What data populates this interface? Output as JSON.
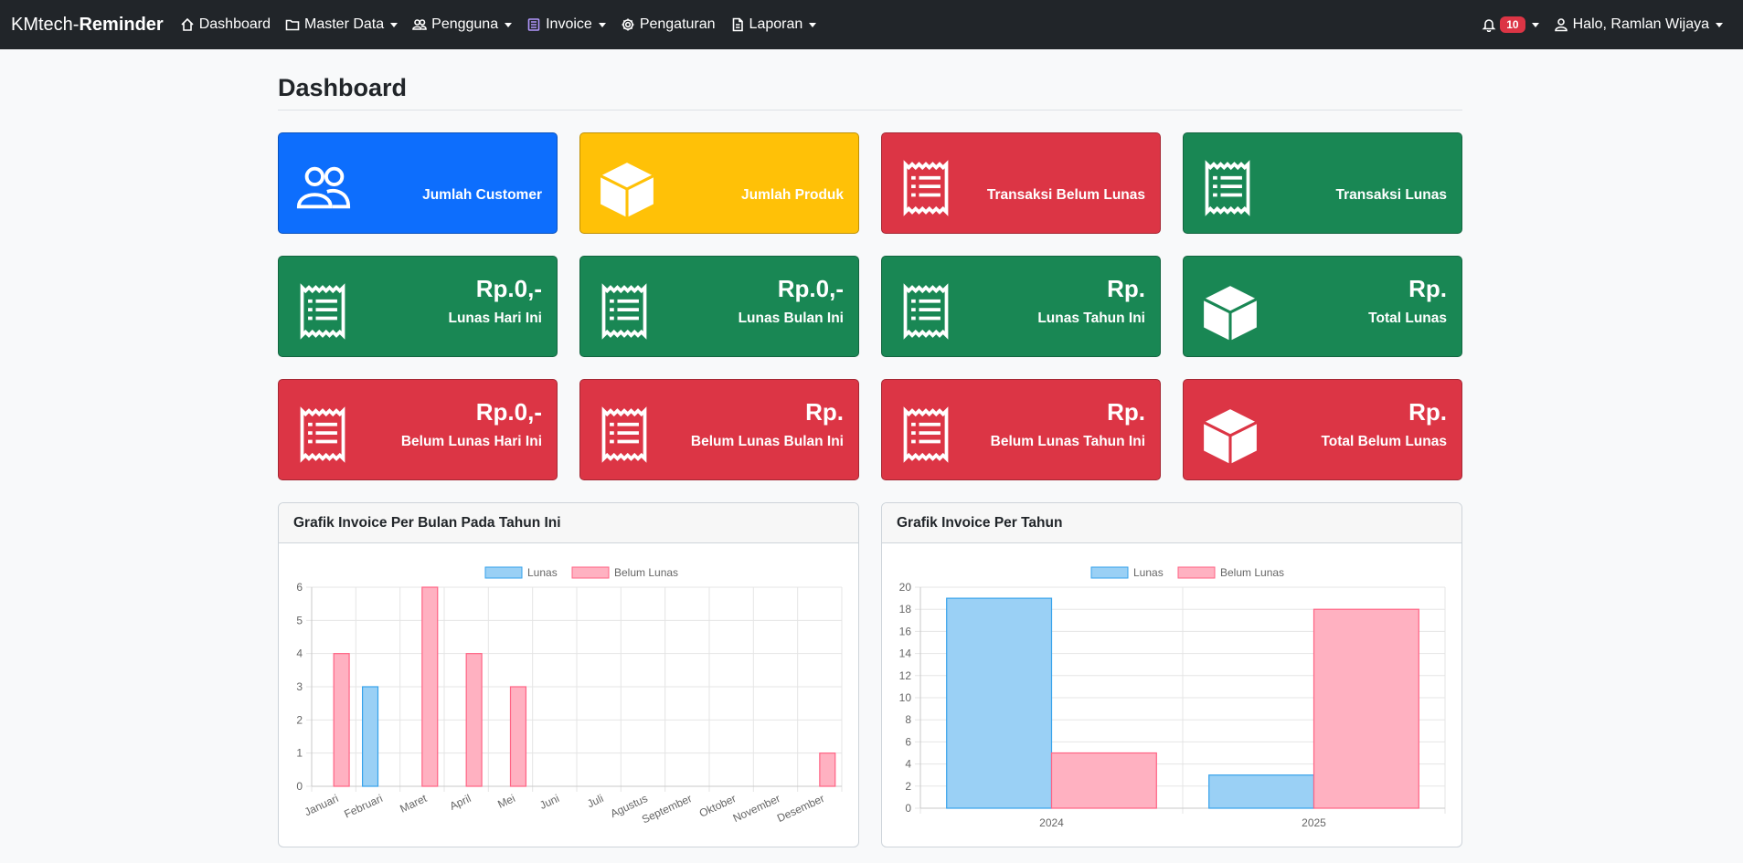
{
  "navbar": {
    "brand_light": "KMtech-",
    "brand_bold": "Reminder",
    "items": [
      {
        "label": "Dashboard"
      },
      {
        "label": "Master Data"
      },
      {
        "label": "Pengguna"
      },
      {
        "label": "Invoice"
      },
      {
        "label": "Pengaturan"
      },
      {
        "label": "Laporan"
      }
    ],
    "notification_count": "10",
    "user_greeting": "Halo, Ramlan Wijaya"
  },
  "page": {
    "title": "Dashboard"
  },
  "cards": [
    {
      "label": "Jumlah Customer",
      "amount": "",
      "color": "#0d6efd",
      "icon": "users-icon"
    },
    {
      "label": "Jumlah Produk",
      "amount": "",
      "color": "#ffc107",
      "icon": "box-icon"
    },
    {
      "label": "Transaksi Belum Lunas",
      "amount": "",
      "color": "#dc3545",
      "icon": "receipt-icon"
    },
    {
      "label": "Transaksi Lunas",
      "amount": "",
      "color": "#198754",
      "icon": "receipt-icon"
    },
    {
      "label": "Lunas Hari Ini",
      "amount": "Rp.0,-",
      "color": "#198754",
      "icon": "receipt-icon"
    },
    {
      "label": "Lunas Bulan Ini",
      "amount": "Rp.0,-",
      "color": "#198754",
      "icon": "receipt-icon"
    },
    {
      "label": "Lunas Tahun Ini",
      "amount": "Rp.",
      "color": "#198754",
      "icon": "receipt-icon"
    },
    {
      "label": "Total Lunas",
      "amount": "Rp.",
      "color": "#198754",
      "icon": "box-icon"
    },
    {
      "label": "Belum Lunas Hari Ini",
      "amount": "Rp.0,-",
      "color": "#dc3545",
      "icon": "receipt-icon"
    },
    {
      "label": "Belum Lunas Bulan Ini",
      "amount": "Rp.",
      "color": "#dc3545",
      "icon": "receipt-icon"
    },
    {
      "label": "Belum Lunas Tahun Ini",
      "amount": "Rp.",
      "color": "#dc3545",
      "icon": "receipt-icon"
    },
    {
      "label": "Total Belum Lunas",
      "amount": "Rp.",
      "color": "#dc3545",
      "icon": "box-icon"
    }
  ],
  "chart_data": [
    {
      "type": "bar",
      "title": "Grafik Invoice Per Bulan Pada Tahun Ini",
      "categories": [
        "Januari",
        "Februari",
        "Maret",
        "April",
        "Mei",
        "Juni",
        "Juli",
        "Agustus",
        "September",
        "Oktober",
        "November",
        "Desember"
      ],
      "series": [
        {
          "name": "Lunas",
          "values": [
            0,
            3,
            0,
            0,
            0,
            0,
            0,
            0,
            0,
            0,
            0,
            0
          ],
          "color": "#36a2eb",
          "fill": "#9ad0f5"
        },
        {
          "name": "Belum Lunas",
          "values": [
            4,
            0,
            6,
            4,
            3,
            0,
            0,
            0,
            0,
            0,
            0,
            1
          ],
          "color": "#ff6384",
          "fill": "#ffb1c1"
        }
      ],
      "ylim": [
        0,
        6
      ],
      "yticks": [
        0,
        1,
        2,
        3,
        4,
        5,
        6
      ],
      "legend": "top",
      "grid": true
    },
    {
      "type": "bar",
      "title": "Grafik Invoice Per Tahun",
      "categories": [
        "2024",
        "2025"
      ],
      "series": [
        {
          "name": "Lunas",
          "values": [
            19,
            3
          ],
          "color": "#36a2eb",
          "fill": "#9ad0f5"
        },
        {
          "name": "Belum Lunas",
          "values": [
            5,
            18
          ],
          "color": "#ff6384",
          "fill": "#ffb1c1"
        }
      ],
      "ylim": [
        0,
        20
      ],
      "yticks": [
        0,
        2,
        4,
        6,
        8,
        10,
        12,
        14,
        16,
        18,
        20
      ],
      "legend": "top",
      "grid": true
    }
  ]
}
